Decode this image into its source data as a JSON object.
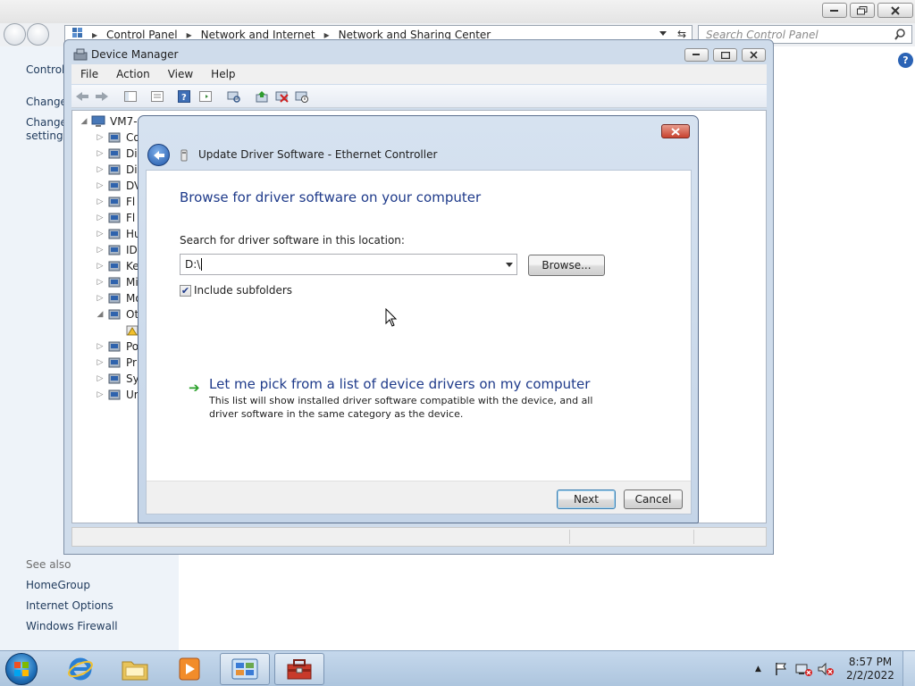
{
  "control_panel": {
    "breadcrumb": [
      "Control Panel",
      "Network and Internet",
      "Network and Sharing Center"
    ],
    "search_placeholder": "Search Control Panel",
    "sidebar_links": [
      "Control",
      "Change",
      "Change",
      "settings"
    ],
    "see_also_label": "See also",
    "see_also_links": [
      "HomeGroup",
      "Internet Options",
      "Windows Firewall"
    ]
  },
  "device_manager": {
    "title": "Device Manager",
    "menu": [
      "File",
      "Action",
      "View",
      "Help"
    ],
    "tree_root": "VM7-",
    "tree_items": [
      {
        "label": "Co",
        "icon": "computer-icon"
      },
      {
        "label": "Di",
        "icon": "disk-drive-icon"
      },
      {
        "label": "Di",
        "icon": "display-adapter-icon"
      },
      {
        "label": "DV",
        "icon": "dvd-drive-icon"
      },
      {
        "label": "Fl",
        "icon": "floppy-controller-icon"
      },
      {
        "label": "Fl",
        "icon": "floppy-drive-icon"
      },
      {
        "label": "Hu",
        "icon": "hid-icon"
      },
      {
        "label": "ID",
        "icon": "ide-controller-icon"
      },
      {
        "label": "Ke",
        "icon": "keyboard-icon"
      },
      {
        "label": "Mi",
        "icon": "mouse-icon"
      },
      {
        "label": "Mo",
        "icon": "monitor-icon"
      },
      {
        "label": "Ot",
        "icon": "other-devices-icon"
      },
      {
        "label": "",
        "icon": "unknown-device-icon"
      },
      {
        "label": "Po",
        "icon": "ports-icon"
      },
      {
        "label": "Pr",
        "icon": "processor-icon"
      },
      {
        "label": "Sy",
        "icon": "system-devices-icon"
      },
      {
        "label": "Ur",
        "icon": "usb-controller-icon"
      }
    ]
  },
  "dialog": {
    "title": "Update Driver Software - Ethernet Controller",
    "heading": "Browse for driver software on your computer",
    "location_label": "Search for driver software in this location:",
    "path_value": "D:\\",
    "browse_label": "Browse...",
    "include_subfolders_label": "Include subfolders",
    "include_subfolders_checked": true,
    "pick_title": "Let me pick from a list of device drivers on my computer",
    "pick_desc": "This list will show installed driver software compatible with the device, and all driver software in the same category as the device.",
    "next_label": "Next",
    "cancel_label": "Cancel"
  },
  "taskbar": {
    "time": "8:57 PM",
    "date": "2/2/2022"
  },
  "colors": {
    "accent_heading": "#1e3a8a",
    "link": "#1e395b",
    "close_red": "#c8422f",
    "green_arrow": "#2aa02a"
  }
}
